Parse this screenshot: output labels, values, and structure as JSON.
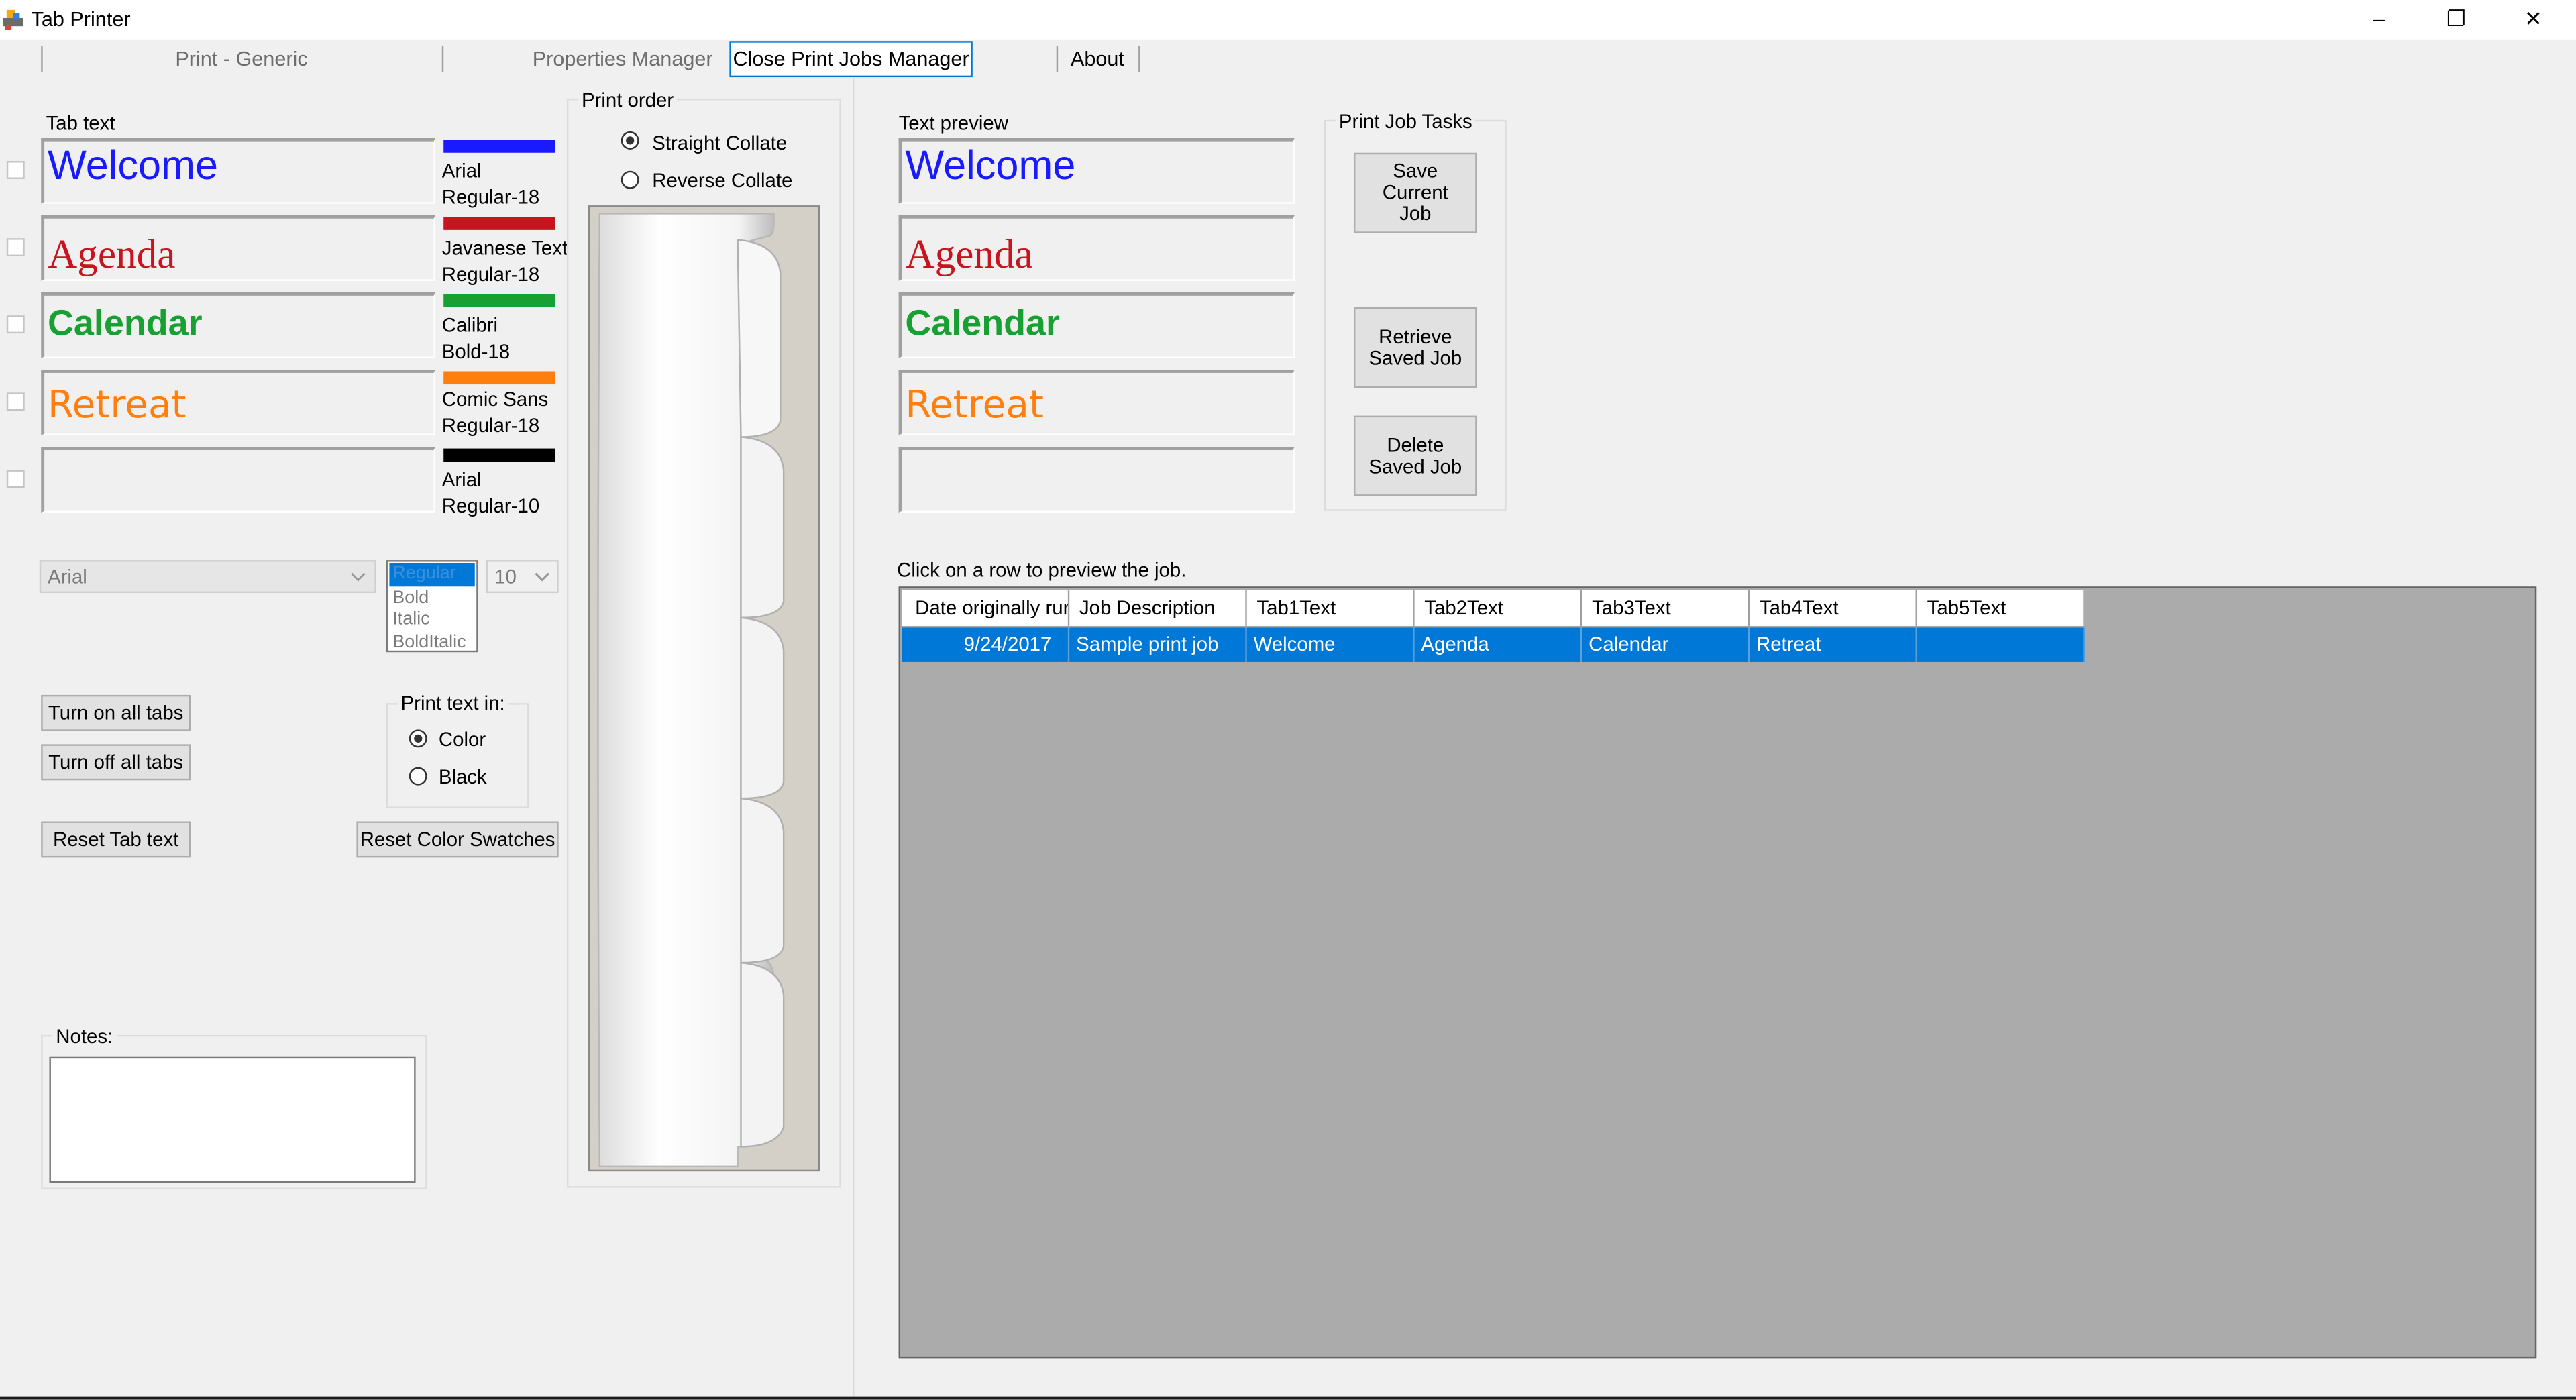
{
  "window": {
    "title": "Tab Printer",
    "minimize": "–",
    "restore": "❐",
    "close": "✕",
    "icon": "tab-printer-app-icon"
  },
  "menu": {
    "items": [
      "Print - Generic",
      "Properties Manager",
      "Close Print Jobs Manager",
      "About"
    ]
  },
  "tab_text": {
    "label": "Tab text",
    "tabs": [
      {
        "text": "Welcome",
        "color": "#1a1aff",
        "font_line1": "Arial",
        "font_line2": "Regular-18"
      },
      {
        "text": "Agenda",
        "color": "#c8141e",
        "font_line1": "Javanese Text",
        "font_line2": "Regular-18"
      },
      {
        "text": "Calendar",
        "color": "#19a033",
        "font_line1": "Calibri",
        "font_line2": "Bold-18"
      },
      {
        "text": "Retreat",
        "color": "#ff7f0e",
        "font_line1": "Comic Sans",
        "font_line2": "Regular-18"
      },
      {
        "text": "",
        "color": "#000000",
        "font_line1": "Arial",
        "font_line2": "Regular-10"
      }
    ]
  },
  "font_controls": {
    "font_family": "Arial",
    "styles": [
      "Regular",
      "Bold",
      "Italic",
      "BoldItalic"
    ],
    "selected_style": "Regular",
    "size": "10"
  },
  "buttons": {
    "turn_on": "Turn on all tabs",
    "turn_off": "Turn off all tabs",
    "reset_text": "Reset Tab text",
    "reset_swatches": "Reset Color Swatches"
  },
  "print_text_in": {
    "label": "Print text in:",
    "options": [
      "Color",
      "Black"
    ],
    "selected": "Color"
  },
  "notes": {
    "label": "Notes:",
    "value": ""
  },
  "print_order": {
    "label": "Print order",
    "options": [
      "Straight Collate",
      "Reverse Collate"
    ],
    "selected": "Straight Collate"
  },
  "preview": {
    "label": "Text preview"
  },
  "job_tasks": {
    "label": "Print Job Tasks",
    "save": "Save Current Job",
    "retrieve": "Retrieve Saved Job",
    "delete": "Delete Saved Job"
  },
  "grid": {
    "hint": "Click on a row to preview the job.",
    "columns": [
      "Date originally run",
      "Job Description",
      "Tab1Text",
      "Tab2Text",
      "Tab3Text",
      "Tab4Text",
      "Tab5Text"
    ],
    "rows": [
      [
        "9/24/2017",
        "Sample print job",
        "Welcome",
        "Agenda",
        "Calendar",
        "Retreat",
        ""
      ]
    ]
  }
}
